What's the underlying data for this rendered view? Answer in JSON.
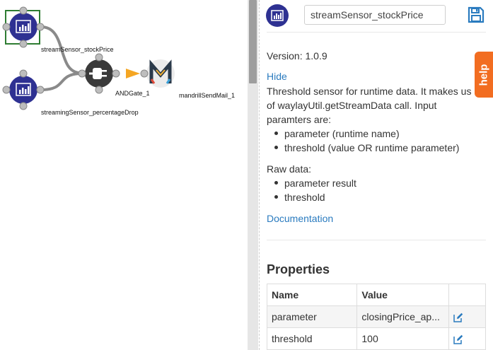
{
  "canvas": {
    "nodes": [
      {
        "id": "streamSensor_stockPrice",
        "label": "streamSensor_stockPrice",
        "icon": "chart-icon",
        "selected": true
      },
      {
        "id": "streamingSensor_percentageDrop",
        "label": "streamingSensor_percentageDrop",
        "icon": "chart-icon"
      },
      {
        "id": "ANDGate_1",
        "label": "ANDGate_1",
        "icon": "plug-icon"
      },
      {
        "id": "mandrillSendMail_1",
        "label": "mandrillSendMail_1",
        "icon": "mandrill-logo-icon"
      }
    ]
  },
  "panel": {
    "name_value": "streamSensor_stockPrice",
    "version": "Version: 1.0.9",
    "hide_link": "Hide",
    "description": [
      "Threshold sensor for runtime data. It makes us",
      "of waylayUtil.getStreamData call. Input",
      "paramters are:"
    ],
    "input_params": [
      "parameter (runtime name)",
      "threshold (value OR runtime parameter)"
    ],
    "raw_data_label": "Raw data:",
    "raw_data": [
      "parameter result",
      "threshold"
    ],
    "documentation_link": "Documentation",
    "properties_title": "Properties",
    "table": {
      "headers": [
        "Name",
        "Value",
        ""
      ],
      "rows": [
        {
          "name": "parameter",
          "value": "closingPrice_ap..."
        },
        {
          "name": "threshold",
          "value": "100"
        }
      ]
    }
  },
  "help_tab": "help",
  "colors": {
    "accent": "#2a7bbf",
    "node": "#2e3192",
    "help": "#f26d21",
    "gate": "#3a3a3a",
    "arrow": "#f5a623"
  }
}
